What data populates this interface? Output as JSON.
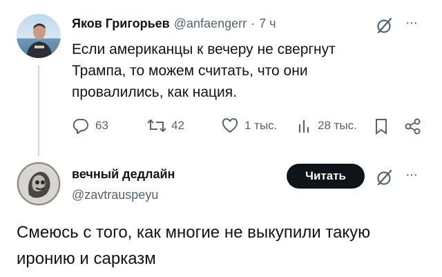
{
  "tweet1": {
    "author_name": "Яков Григорьев",
    "handle": "@anfaengerr",
    "separator": "·",
    "time": "7 ч",
    "text_lines": [
      "Если американцы к вечеру не свергнут",
      "Трампа, то можем считать, что они",
      "провалились, как нация."
    ],
    "actions": {
      "replies": "63",
      "reposts": "42",
      "likes": "1 тыс.",
      "views": "28 тыс."
    },
    "more": "···"
  },
  "tweet2": {
    "author_name": "вечный дедлайн",
    "handle": "@zavtrauspeyu",
    "follow_label": "Читать",
    "more": "···",
    "text_lines": [
      "Смеюсь с того, как многие не выкупили такую",
      "иронию и сарказм"
    ]
  },
  "colors": {
    "text": "#0f1419",
    "muted": "#536471",
    "thread_line": "#cfd9de",
    "follow_bg": "#0f1419"
  },
  "icons": [
    "grok-icon",
    "more-icon",
    "reply-icon",
    "repost-icon",
    "like-icon",
    "views-icon",
    "bookmark-icon",
    "share-icon"
  ]
}
